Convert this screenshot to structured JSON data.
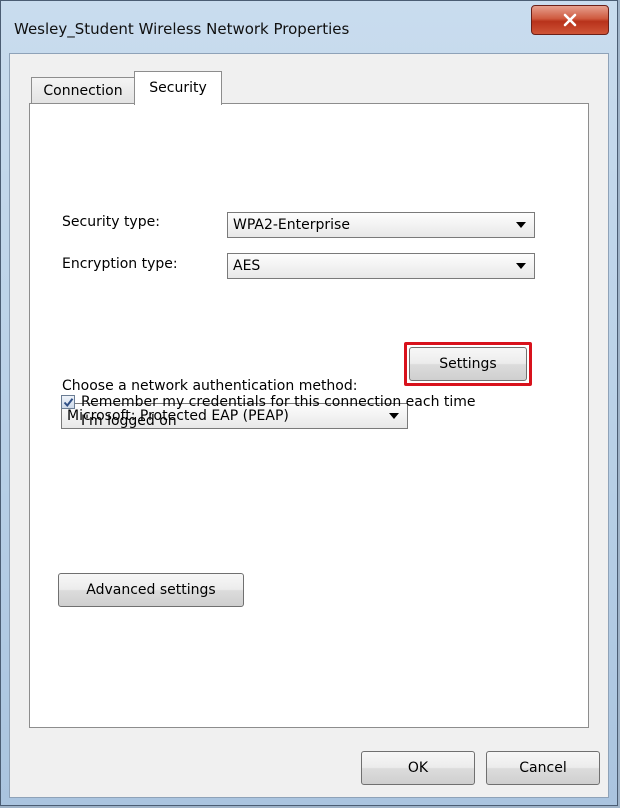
{
  "window": {
    "title": "Wesley_Student Wireless Network Properties",
    "close_icon": "close-icon"
  },
  "tabs": [
    {
      "label": "Connection",
      "active": false
    },
    {
      "label": "Security",
      "active": true
    }
  ],
  "security": {
    "security_type_label": "Security type:",
    "security_type_value": "WPA2-Enterprise",
    "encryption_type_label": "Encryption type:",
    "encryption_type_value": "AES",
    "auth_method_label": "Choose a network authentication method:",
    "auth_method_value": "Microsoft: Protected EAP (PEAP)",
    "settings_button": "Settings",
    "remember_checked": true,
    "remember_label": "Remember my credentials for this connection each time I'm logged on",
    "advanced_button": "Advanced settings"
  },
  "footer": {
    "ok_button": "OK",
    "cancel_button": "Cancel"
  },
  "colors": {
    "highlight": "#d8121c",
    "close_button": "#c5452a"
  }
}
